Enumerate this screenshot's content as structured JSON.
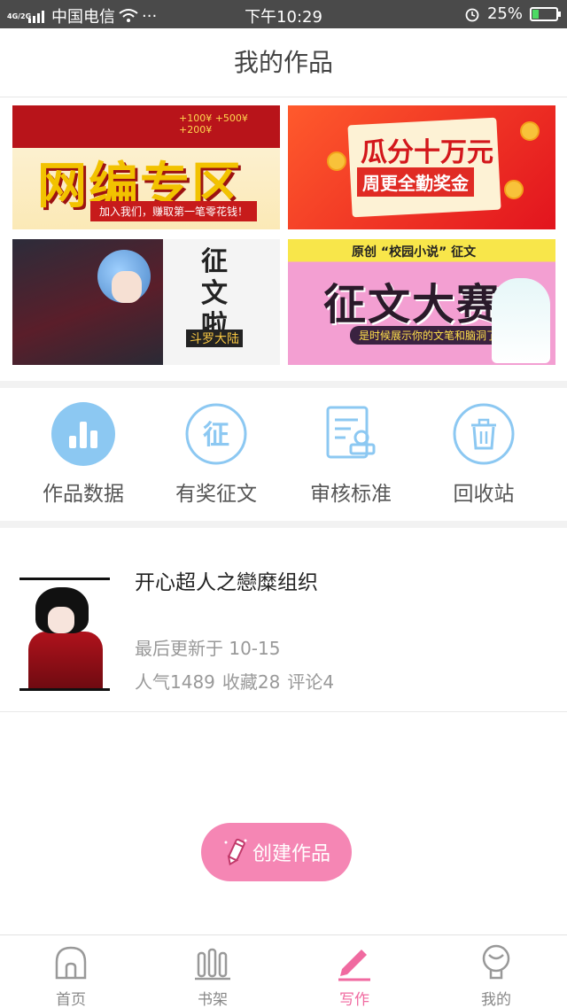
{
  "status_bar": {
    "network": "4G/2G",
    "carrier": "中国电信",
    "more": "···",
    "time": "下午10:29",
    "battery": "25%",
    "battery_level": 0.25
  },
  "header": {
    "title": "我的作品"
  },
  "banners": [
    {
      "name": "banner-web-novel",
      "title": "网编专区",
      "tag": "加入我们，赚取第一笔零花钱！",
      "coins": "+100¥  +500¥  +200¥"
    },
    {
      "name": "banner-attendance-bonus",
      "line1": "瓜分十万元",
      "line2": "周更全勤奖金"
    },
    {
      "name": "banner-contest-doupo",
      "title": "征文啦",
      "tag": "斗罗大陆"
    },
    {
      "name": "banner-campus-contest",
      "top": "原创 “校园小说” 征文",
      "title": "征文大赛",
      "pill": "是时候展示你的文笔和脑洞了！"
    }
  ],
  "menu": [
    {
      "label": "作品数据",
      "icon": "bar-chart-icon"
    },
    {
      "label": "有奖征文",
      "icon": "contest-seal-icon"
    },
    {
      "label": "审核标准",
      "icon": "review-document-icon"
    },
    {
      "label": "回收站",
      "icon": "trash-icon"
    }
  ],
  "work": {
    "title": "开心超人之戀糜组织",
    "updated": "最后更新于 10-15",
    "popularity": "人气1489",
    "favorites": "收藏28",
    "comments": "评论4"
  },
  "create_button": {
    "label": "创建作品",
    "icon": "pencil-icon"
  },
  "tabs": [
    {
      "label": "首页",
      "icon": "home-icon",
      "active": false
    },
    {
      "label": "书架",
      "icon": "bookshelf-icon",
      "active": false
    },
    {
      "label": "写作",
      "icon": "write-pencil-icon",
      "active": true
    },
    {
      "label": "我的",
      "icon": "profile-icon",
      "active": false
    }
  ],
  "colors": {
    "accent": "#f06aa0",
    "menu_icon": "#8cc8f2",
    "status_bar": "#4a4a4a"
  }
}
